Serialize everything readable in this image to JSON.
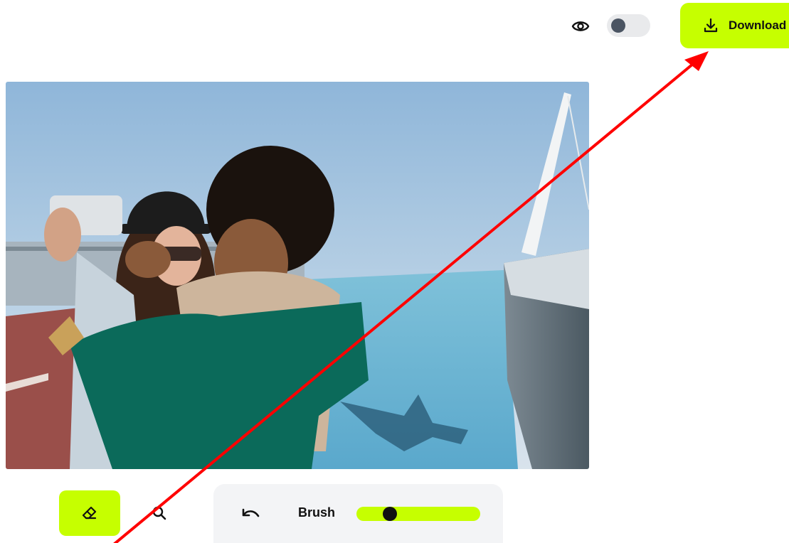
{
  "header": {
    "preview_icon": "eye-icon",
    "preview_toggle_on": false,
    "download_label": "Download",
    "download_icon": "download-icon",
    "accent_color": "#c6ff00"
  },
  "photo": {
    "description_icon": "image"
  },
  "toolbar": {
    "eraser_icon": "eraser-icon",
    "zoom_icon": "search-icon",
    "undo_icon": "undo-icon",
    "brush_label": "Brush",
    "brush_size_fraction": 0.24
  },
  "annotation": {
    "color": "#ff0000",
    "type": "arrow"
  }
}
